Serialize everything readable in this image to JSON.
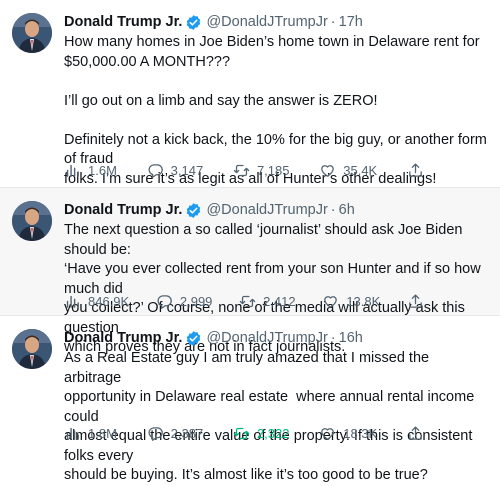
{
  "tweets": [
    {
      "name": "Donald Trump Jr.",
      "handle": "@DonaldJTrumpJr",
      "separator": "·",
      "time": "17h",
      "text": "How many homes in Joe Biden’s home town in Delaware rent for\n$50,000.00 A MONTH???\n\nI’ll go out on a limb and say the answer is ZERO!\n\nDefinitely not a kick back, the 10% for the big guy, or another form of fraud\nfolks. I’m sure it’s as legit as all of Hunter’s other dealings!",
      "views": "1.6M",
      "replies": "3,147",
      "retweets": "7,185",
      "likes": "35.4K",
      "retweeted": false
    },
    {
      "name": "Donald Trump Jr.",
      "handle": "@DonaldJTrumpJr",
      "separator": "·",
      "time": "6h",
      "text": "The next question a so called ‘journalist’ should ask Joe Biden should be:\n‘Have you ever collected rent from your son Hunter and if so how much did\nyou collect?’ Of course, none of the media will actually ask this question\nwhich proves they are not in fact journalists.",
      "views": "846.9K",
      "replies": "2,999",
      "retweets": "2,412",
      "likes": "13.8K",
      "retweeted": false
    },
    {
      "name": "Donald Trump Jr.",
      "handle": "@DonaldJTrumpJr",
      "separator": "·",
      "time": "16h",
      "text": "As a Real Estate guy I am truly amazed that I missed the arbitrage\nopportunity in Delaware real estate  where annual rental income could\nalmost equal the entire value of the property. If this is consistent folks every\nshould be buying. It’s almost like it’s too good to be true?",
      "views": "1.8M",
      "replies": "2,387",
      "retweets": "2,322",
      "likes": "18.3K",
      "retweeted": true
    }
  ],
  "colors": {
    "verified": "#1d9bf0",
    "retweet_active": "#00ba7c",
    "secondary_text": "#536471",
    "shaded_background": "#f7f7f7"
  },
  "icons": [
    "avatar",
    "verified-badge-icon",
    "views-icon",
    "reply-icon",
    "retweet-icon",
    "like-icon",
    "share-icon"
  ]
}
